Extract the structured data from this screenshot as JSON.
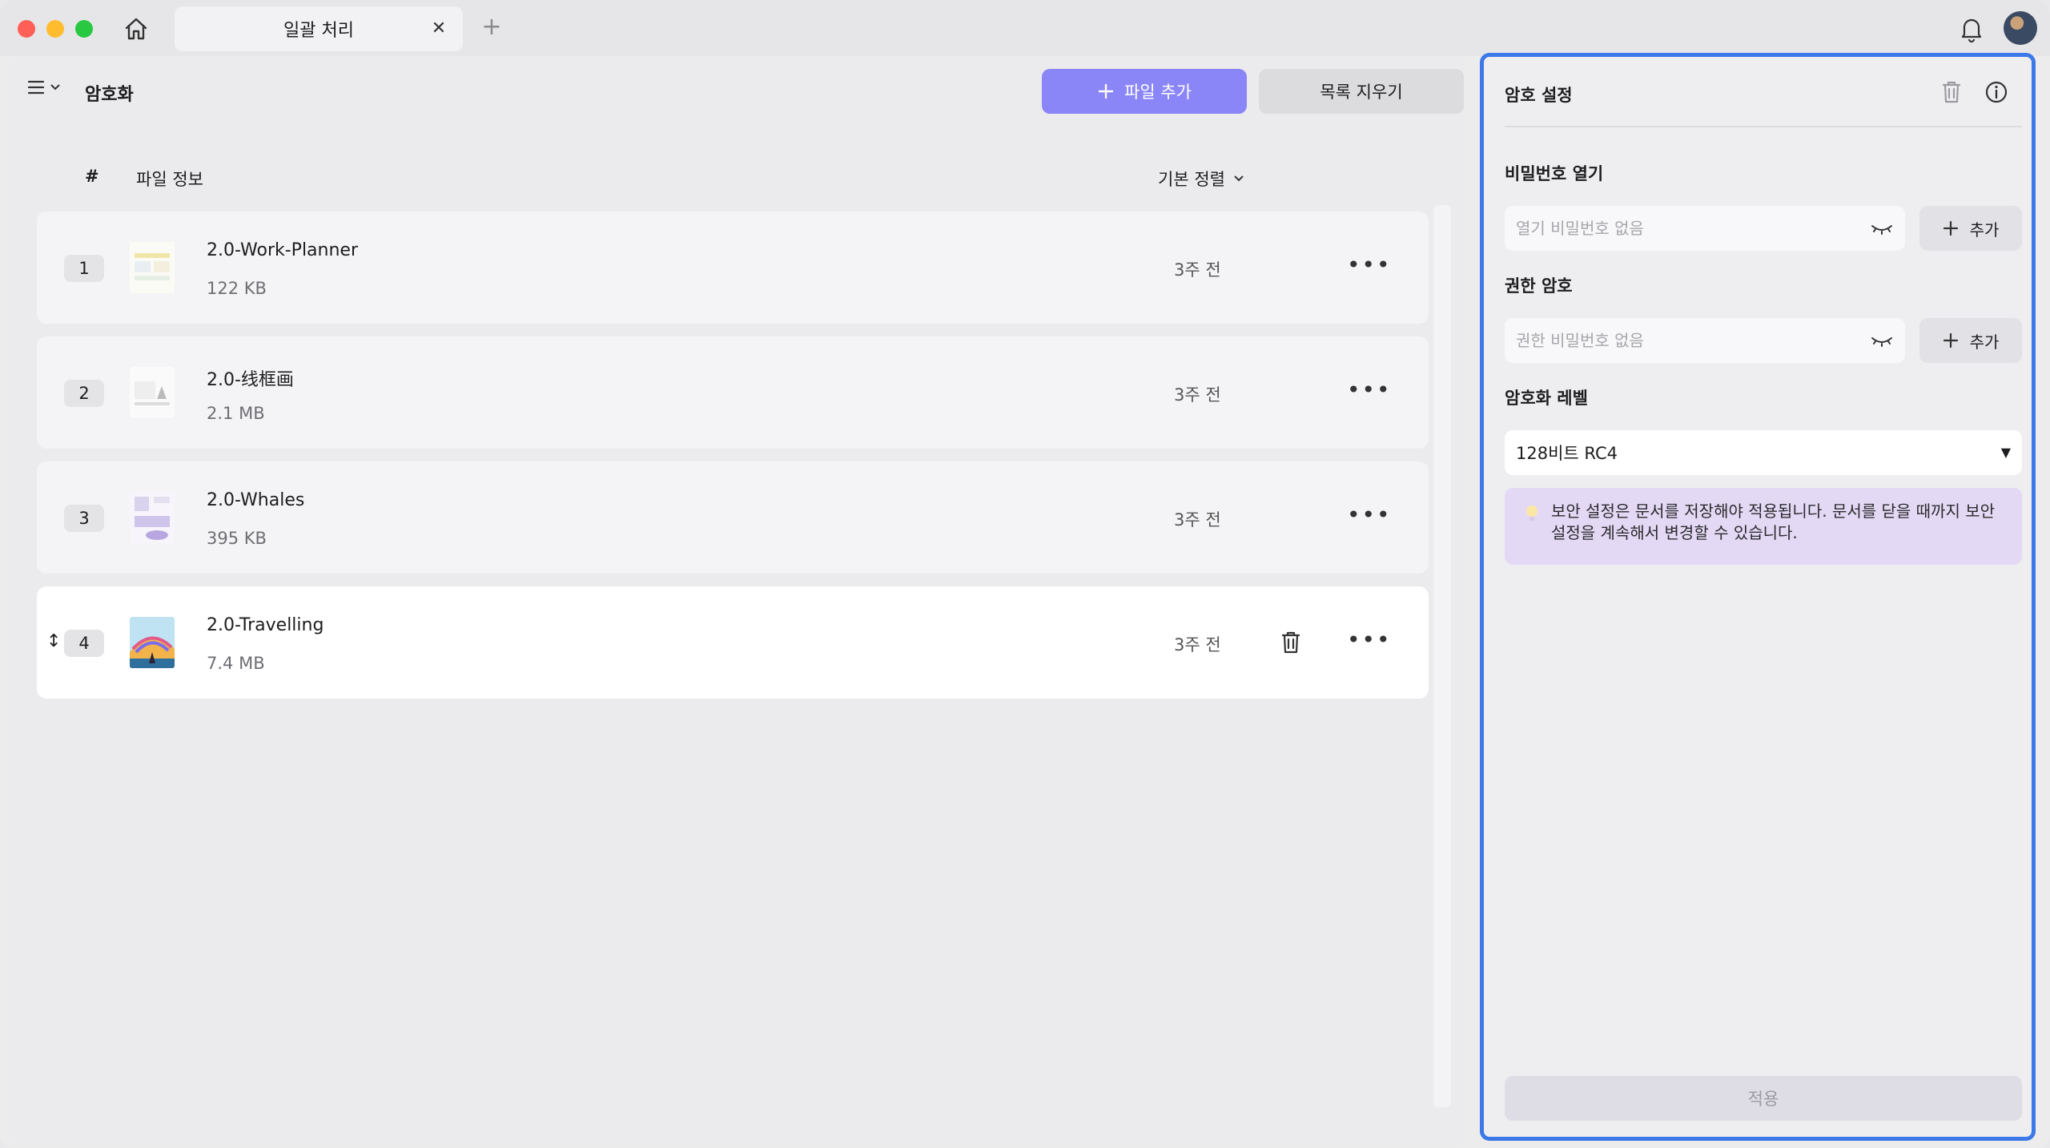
{
  "tab": {
    "title": "일괄 처리",
    "close": "✕",
    "new": "+"
  },
  "toolbar": {
    "title": "암호화",
    "add_label": "파일 추가",
    "clear_label": "목록 지우기"
  },
  "list": {
    "col_hash": "#",
    "col_info": "파일 정보",
    "sort_label": "기본 정렬",
    "rows": [
      {
        "num": "1",
        "name": "2.0-Work-Planner",
        "size": "122 KB",
        "date": "3주 전"
      },
      {
        "num": "2",
        "name": "2.0-线框画",
        "size": "2.1 MB",
        "date": "3주 전"
      },
      {
        "num": "3",
        "name": "2.0-Whales",
        "size": "395 KB",
        "date": "3주 전"
      },
      {
        "num": "4",
        "name": "2.0-Travelling",
        "size": "7.4 MB",
        "date": "3주 전",
        "handle": "↕"
      }
    ]
  },
  "panel": {
    "title": "암호 설정",
    "open_label": "비밀번호 열기",
    "open_placeholder": "열기 비밀번호 없음",
    "perm_label": "권한 암호",
    "perm_placeholder": "권한 비밀번호 없음",
    "add_label": "추가",
    "level_label": "암호화 레벨",
    "level_value": "128비트 RC4",
    "notice": "보안 설정은 문서를 저장해야 적용됩니다. 문서를 닫을 때까지 보안 설정을 계속해서 변경할 수 있습니다.",
    "apply_label": "적용"
  },
  "colors": {
    "accent": "#8b86f7",
    "panel_border": "#3c78e8",
    "notice_bg": "#e4d9f4"
  }
}
